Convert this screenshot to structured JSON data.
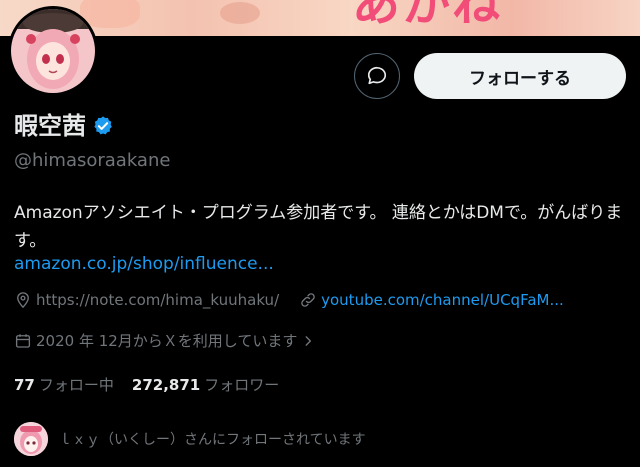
{
  "banner": {
    "text": "あかね"
  },
  "profile": {
    "display_name": "暇空茜",
    "handle": "@himasoraakane",
    "verified_icon": "verified-badge-icon",
    "bio": "Amazonアソシエイト・プログラム参加者です。 連絡とかはDMで。がんばります。",
    "bio_link": "amazon.co.jp/shop/influence..."
  },
  "actions": {
    "message_icon": "message-bubble-icon",
    "follow_label": "フォローする"
  },
  "meta": {
    "location": "https://note.com/hima_kuuhaku/",
    "website": "youtube.com/channel/UCqFaM...",
    "joined": "2020 年 12月からＸを利用しています"
  },
  "stats": {
    "following_count": "77",
    "following_label": "フォロー中",
    "followers_count": "272,871",
    "followers_label": "フォロワー"
  },
  "followed_by": {
    "text": "ｌｘｙ（いくしー）さんにフォローされています"
  },
  "colors": {
    "accent": "#1d9bf0",
    "background": "#000000",
    "muted": "#71767b",
    "text": "#e7e9ea"
  }
}
